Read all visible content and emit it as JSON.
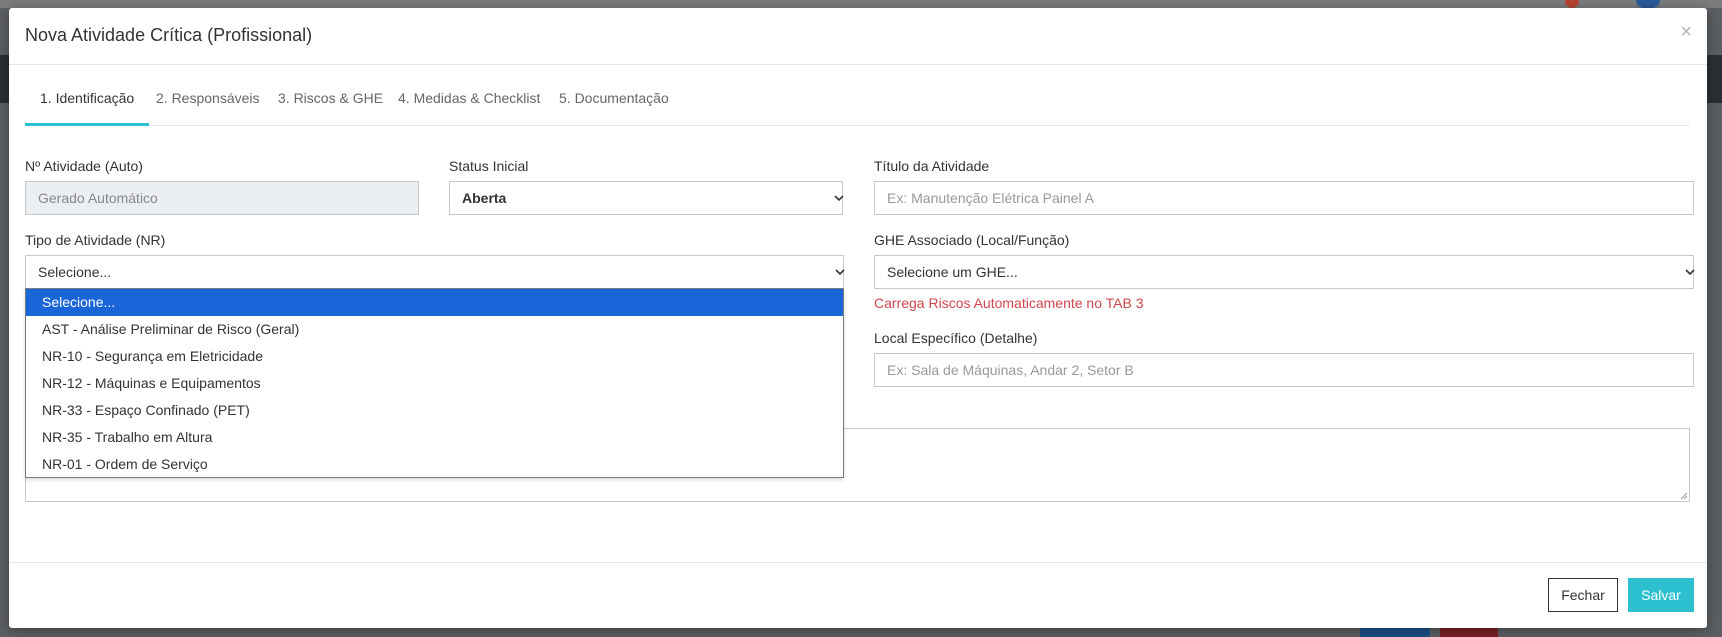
{
  "modal": {
    "title": "Nova Atividade Crítica (Profissional)",
    "close_icon": "close-icon"
  },
  "tabs": [
    {
      "label": "1. Identificação",
      "active": true
    },
    {
      "label": "2. Responsáveis",
      "active": false
    },
    {
      "label": "3. Riscos & GHE",
      "active": false
    },
    {
      "label": "4. Medidas & Checklist",
      "active": false
    },
    {
      "label": "5. Documentação",
      "active": false
    }
  ],
  "form": {
    "numero": {
      "label": "Nº Atividade (Auto)",
      "placeholder": "Gerado Automático"
    },
    "status": {
      "label": "Status Inicial",
      "value": "Aberta"
    },
    "titulo": {
      "label": "Título da Atividade",
      "placeholder": "Ex: Manutenção Elétrica Painel A"
    },
    "tipo": {
      "label": "Tipo de Atividade (NR)",
      "value": "Selecione...",
      "options": [
        "Selecione...",
        "AST - Análise Preliminar de Risco (Geral)",
        "NR-10 - Segurança em Eletricidade",
        "NR-12 - Máquinas e Equipamentos",
        "NR-33 - Espaço Confinado (PET)",
        "NR-35 - Trabalho em Altura",
        "NR-01 - Ordem de Serviço"
      ]
    },
    "ghe": {
      "label": "GHE Associado (Local/Função)",
      "value": "Selecione um GHE...",
      "hint": "Carrega Riscos Automaticamente no TAB 3"
    },
    "local": {
      "label": "Local Específico (Detalhe)",
      "placeholder": "Ex: Sala de Máquinas, Andar 2, Setor B"
    }
  },
  "footer": {
    "close_label": "Fechar",
    "save_label": "Salvar"
  },
  "colors": {
    "accent": "#2cc0d1",
    "hint": "#d0464c",
    "selected_option": "#1a66d8"
  }
}
